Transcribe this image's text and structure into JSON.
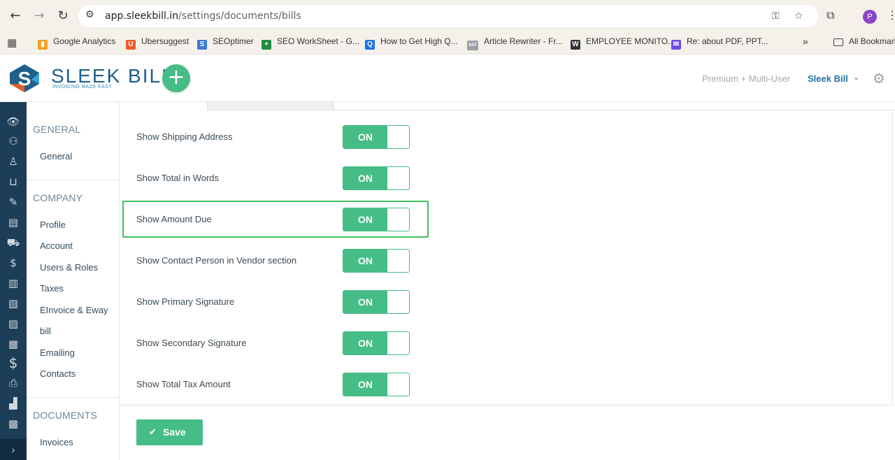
{
  "browser": {
    "url_host": "app.sleekbill.in",
    "url_path": "/settings/documents/bills",
    "profile_initial": "P",
    "bookmarks": [
      {
        "label": "Google Analytics",
        "color": "#f4a024",
        "glyph": "▮"
      },
      {
        "label": "Ubersuggest",
        "color": "#f05a28",
        "glyph": "U"
      },
      {
        "label": "SEOptimer",
        "color": "#3b78d8",
        "glyph": "S"
      },
      {
        "label": "SEO WorkSheet - G...",
        "color": "#1e8e3e",
        "glyph": "+"
      },
      {
        "label": "How to Get High Q...",
        "color": "#1a73e8",
        "glyph": "Q"
      },
      {
        "label": "Article Rewriter - Fr...",
        "color": "#9aa0a6",
        "glyph": "SST"
      },
      {
        "label": "EMPLOYEE MONITO...",
        "color": "#333333",
        "glyph": "W"
      },
      {
        "label": "Re: about PDF, PPT...",
        "color": "#6b4ce6",
        "glyph": "✉"
      }
    ],
    "more_label": "»",
    "all_bookmarks_label": "All Bookmarks"
  },
  "app": {
    "logo_text": "SLEEK BILL",
    "logo_tagline": "INVOICING MADE EASY",
    "plan_label": "Premium + Multi-User",
    "company_label": "Sleek Bill"
  },
  "sidebar": {
    "sections": [
      {
        "title": "GENERAL",
        "items": [
          "General"
        ]
      },
      {
        "title": "COMPANY",
        "items": [
          "Profile",
          "Account",
          "Users & Roles",
          "Taxes",
          "EInvoice & Eway",
          "bill",
          "Emailing",
          "Contacts"
        ]
      },
      {
        "title": "DOCUMENTS",
        "items": [
          "Invoices"
        ]
      }
    ]
  },
  "settings": {
    "rows": [
      {
        "label": "Show Shipping Address",
        "state": "ON"
      },
      {
        "label": "Show Total in Words",
        "state": "ON"
      },
      {
        "label": "Show Amount Due",
        "state": "ON"
      },
      {
        "label": "Show Contact Person in Vendor section",
        "state": "ON"
      },
      {
        "label": "Show Primary Signature",
        "state": "ON"
      },
      {
        "label": "Show Secondary Signature",
        "state": "ON"
      },
      {
        "label": "Show Total Tax Amount",
        "state": "ON"
      }
    ],
    "save_label": "Save"
  },
  "colors": {
    "accent_green": "#46bd86",
    "highlight_green": "#3fbf5a",
    "brand_blue": "#1f5f8c",
    "rail_navy": "#1c3e56"
  }
}
